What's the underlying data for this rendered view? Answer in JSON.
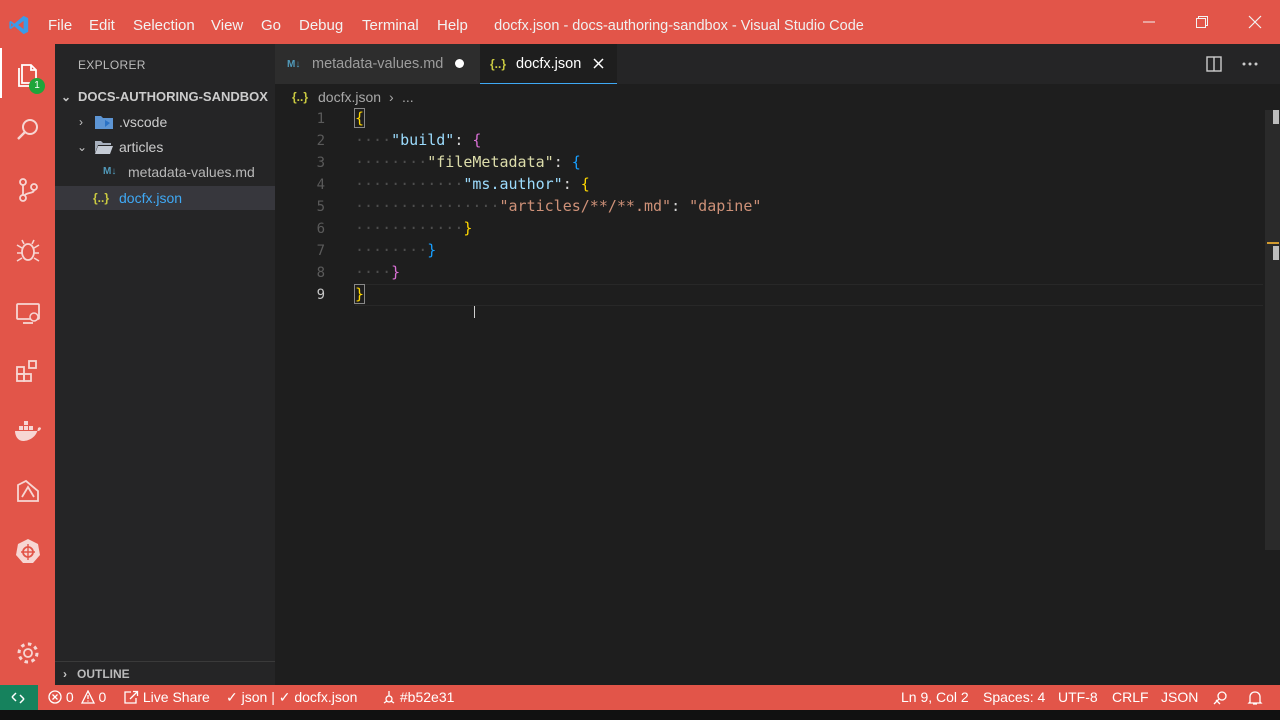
{
  "titlebar": {
    "menu": [
      "File",
      "Edit",
      "Selection",
      "View",
      "Go",
      "Debug",
      "Terminal",
      "Help"
    ],
    "window_title": "docfx.json - docs-authoring-sandbox - Visual Studio Code",
    "icons": [
      "minimize-icon",
      "restore-icon",
      "close-icon"
    ]
  },
  "activity_bar": {
    "items": [
      "explorer-icon",
      "search-icon",
      "source-control-icon",
      "debug-icon",
      "remote-explorer-icon",
      "extensions-icon",
      "docker-icon",
      "azure-icon",
      "kubernetes-icon"
    ],
    "explorer_badge": "1",
    "bottom": "gear-icon"
  },
  "sidebar": {
    "header": "EXPLORER",
    "workspace": "DOCS-AUTHORING-SANDBOX",
    "tree": [
      {
        "label": ".vscode",
        "type": "folder"
      },
      {
        "label": "articles",
        "type": "folder"
      },
      {
        "label": "metadata-values.md",
        "type": "md",
        "icon_text": "M↓"
      },
      {
        "label": "docfx.json",
        "type": "json",
        "icon_text": "{..}"
      }
    ],
    "outline": "OUTLINE"
  },
  "tabs": [
    {
      "label": "metadata-values.md",
      "icon_text": "M↓",
      "modified": true,
      "active": false
    },
    {
      "label": "docfx.json",
      "icon_text": "{..}",
      "modified": false,
      "active": true
    }
  ],
  "breadcrumb": {
    "icon_text": "{..}",
    "file": "docfx.json",
    "sep": "›",
    "more": "..."
  },
  "editor": {
    "line_numbers": [
      "1",
      "2",
      "3",
      "4",
      "5",
      "6",
      "7",
      "8",
      "9"
    ],
    "code": {
      "build_key": "\"build\"",
      "filemeta_key": "\"fileMetadata\"",
      "author_key": "\"ms.author\"",
      "glob_key": "\"articles/**/**.md\"",
      "author_value": "\"dapine\""
    }
  },
  "statusbar": {
    "remote_icon": "remote-icon",
    "errors": "0",
    "warnings": "0",
    "live_share": "Live Share",
    "json_check": "json",
    "file_check": "docfx.json",
    "commit": "#b52e31",
    "position": "Ln 9, Col 2",
    "spaces": "Spaces: 4",
    "encoding": "UTF-8",
    "eol": "CRLF",
    "language": "JSON",
    "icons": [
      "feedback-icon",
      "bell-icon"
    ]
  },
  "colors": {
    "theme_accent": "#e25549",
    "editor_bg": "#1e1e1e",
    "sidebar_bg": "#252526",
    "selection_text": "#3fa9f5"
  }
}
